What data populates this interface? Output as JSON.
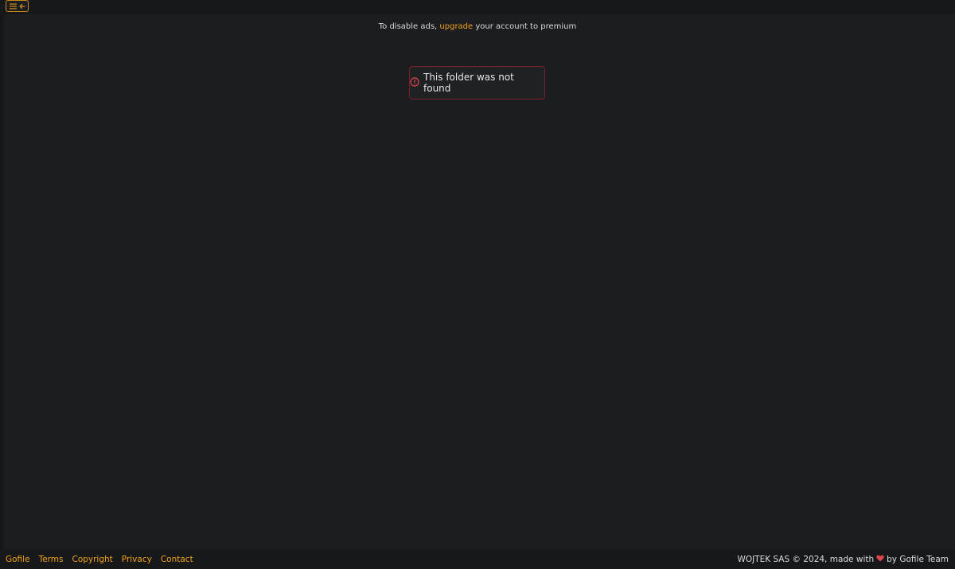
{
  "header": {
    "toggle_icons": [
      "menu-icon",
      "arrow-left-icon"
    ]
  },
  "ads": {
    "prefix": "To disable ads, ",
    "link_label": "upgrade",
    "suffix": " your account to premium"
  },
  "alert": {
    "icon": "exclamation-circle-icon",
    "message": "This folder was not found"
  },
  "footer": {
    "links": [
      "Gofile",
      "Terms",
      "Copyright",
      "Privacy",
      "Contact"
    ],
    "credit_prefix": "WOJTEK SAS © 2024, made with",
    "credit_suffix": "by Gofile Team",
    "heart_icon": "heart-icon"
  },
  "colors": {
    "accent": "#f0a21c",
    "background": "#1c1d20",
    "alert_border": "#7a2323",
    "heart": "#e0454b"
  }
}
